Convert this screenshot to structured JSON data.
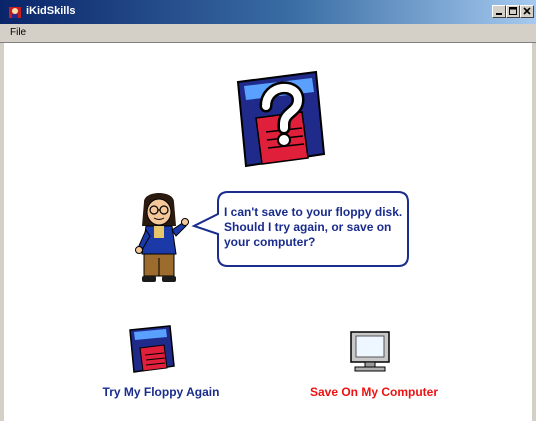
{
  "window": {
    "title": "iKidSkills"
  },
  "menu": {
    "file": "File"
  },
  "dialog": {
    "message": "I can't save to your floppy disk.  Should I try again, or save on your computer?"
  },
  "options": {
    "try_floppy": "Try My Floppy Again",
    "save_computer": "Save On My Computer"
  },
  "colors": {
    "titlebar_start": "#0a246a",
    "message_text": "#1a2c8c",
    "floppy_option_text": "#1a2c8c",
    "computer_option_text": "#ee1111"
  },
  "icons": {
    "app": "app-icon",
    "big_floppy": "floppy-question-icon",
    "character": "character-icon",
    "small_floppy": "floppy-disk-icon",
    "computer": "computer-monitor-icon"
  }
}
